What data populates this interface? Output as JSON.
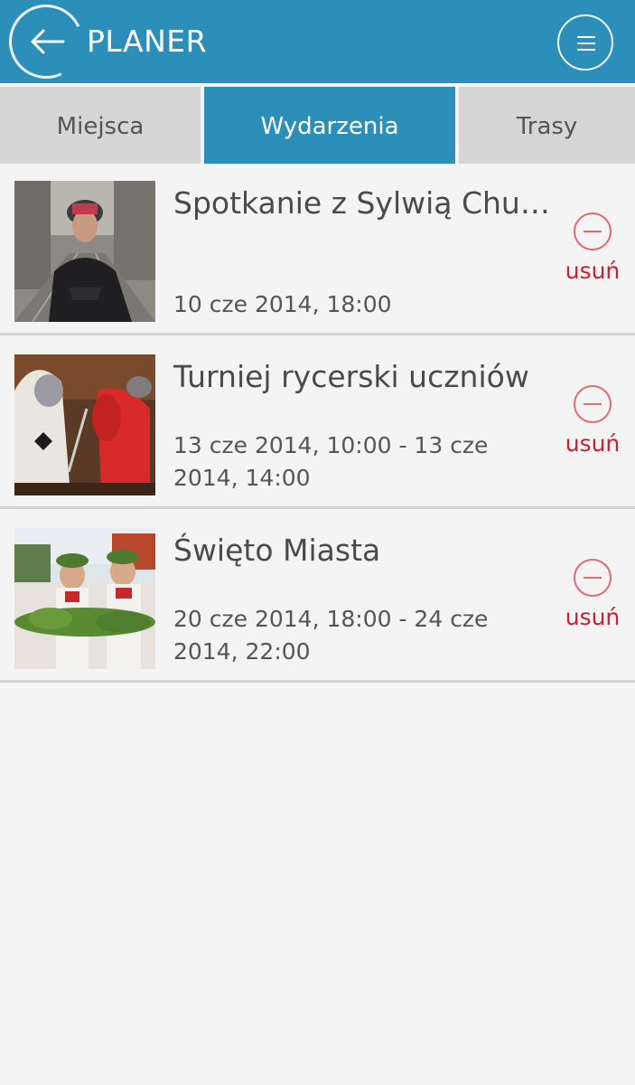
{
  "header": {
    "title": "PLANER",
    "back_icon": "arrow-left-icon",
    "menu_icon": "menu-icon",
    "color": "#2b8fba"
  },
  "tabs": [
    {
      "label": "Miejsca",
      "active": false
    },
    {
      "label": "Wydarzenia",
      "active": true
    },
    {
      "label": "Trasy",
      "active": false
    }
  ],
  "events": [
    {
      "title": "Spotkanie z Sylwią Chut...",
      "date": "10 cze 2014, 18:00",
      "remove_label": "usuń",
      "remove_icon": "minus-circle-icon"
    },
    {
      "title": "Turniej rycerski uczniów",
      "date": "13 cze 2014, 10:00 - 13 cze 2014, 14:00",
      "remove_label": "usuń",
      "remove_icon": "minus-circle-icon"
    },
    {
      "title": "Święto Miasta",
      "date": "20 cze 2014, 18:00 - 24 cze 2014, 22:00",
      "remove_label": "usuń",
      "remove_icon": "minus-circle-icon"
    }
  ],
  "colors": {
    "accent": "#2b8fba",
    "remove": "#c8202e",
    "background": "#f4f4f4"
  }
}
